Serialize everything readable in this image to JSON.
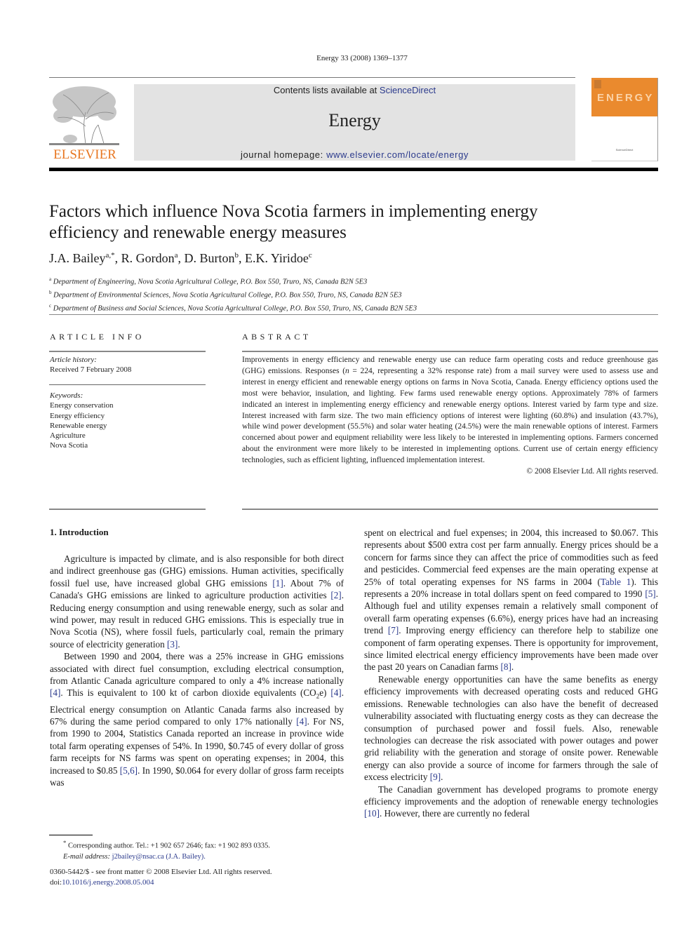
{
  "header": {
    "journal_ref": "Energy 33 (2008) 1369–1377",
    "contents_prefix": "Contents lists available at ",
    "contents_link": "ScienceDirect",
    "journal_name": "Energy",
    "homepage_prefix": "journal homepage: ",
    "homepage_link": "www.elsevier.com/locate/energy",
    "publisher_logo": "ELSEVIER",
    "cover_title": "ENERGY",
    "cover_footer": "ScienceDirect",
    "colors": {
      "brand_orange": "#e87722",
      "link_blue": "#2b3a8c",
      "banner_grey": "#e3e3e3"
    }
  },
  "article": {
    "title": "Factors which influence Nova Scotia farmers in implementing energy efficiency and renewable energy measures",
    "authors": [
      {
        "name": "J.A. Bailey",
        "sup": "a,*"
      },
      {
        "name": "R. Gordon",
        "sup": "a"
      },
      {
        "name": "D. Burton",
        "sup": "b"
      },
      {
        "name": "E.K. Yiridoe",
        "sup": "c"
      }
    ],
    "affiliations": [
      {
        "sup": "a",
        "text": "Department of Engineering, Nova Scotia Agricultural College, P.O. Box 550, Truro, NS, Canada B2N 5E3"
      },
      {
        "sup": "b",
        "text": "Department of Environmental Sciences, Nova Scotia Agricultural College, P.O. Box 550, Truro, NS, Canada B2N 5E3"
      },
      {
        "sup": "c",
        "text": "Department of Business and Social Sciences, Nova Scotia Agricultural College, P.O. Box 550, Truro, NS, Canada B2N 5E3"
      }
    ]
  },
  "article_info": {
    "heading": "ARTICLE INFO",
    "history_label": "Article history:",
    "received": "Received 7 February 2008",
    "keywords_label": "Keywords:",
    "keywords": [
      "Energy conservation",
      "Energy efficiency",
      "Renewable energy",
      "Agriculture",
      "Nova Scotia"
    ]
  },
  "abstract": {
    "heading": "ABSTRACT",
    "text_1": "Improvements in energy efficiency and renewable energy use can reduce farm operating costs and reduce greenhouse gas (GHG) emissions. Responses (",
    "n_var": "n",
    "text_2": " = 224, representing a 32% response rate) from a mail survey were used to assess use and interest in energy efficient and renewable energy options on farms in Nova Scotia, Canada. Energy efficiency options used the most were behavior, insulation, and lighting. Few farms used renewable energy options. Approximately 78% of farmers indicated an interest in implementing energy efficiency and renewable energy options. Interest varied by farm type and size. Interest increased with farm size. The two main efficiency options of interest were lighting (60.8%) and insulation (43.7%), while wind power development (55.5%) and solar water heating (24.5%) were the main renewable options of interest. Farmers concerned about power and equipment reliability were less likely to be interested in implementing options. Farmers concerned about the environment were more likely to be interested in implementing options. Current use of certain energy efficiency technologies, such as efficient lighting, influenced implementation interest.",
    "copyright": "© 2008 Elsevier Ltd. All rights reserved."
  },
  "body": {
    "section_heading": "1.  Introduction",
    "left": {
      "p1": [
        "Agriculture is impacted by climate, and is also responsible for both direct and indirect greenhouse gas (GHG) emissions. Human activities, specifically fossil fuel use, have increased global GHG emissions ",
        "[1]",
        ". About 7% of Canada's GHG emissions are linked to agriculture production activities ",
        "[2]",
        ". Reducing energy consumption and using renewable energy, such as solar and wind power, may result in reduced GHG emissions. This is especially true in Nova Scotia (NS), where fossil fuels, particularly coal, remain the primary source of electricity generation ",
        "[3]",
        "."
      ],
      "p2": [
        "Between 1990 and 2004, there was a 25% increase in GHG emissions associated with direct fuel consumption, excluding electrical consumption, from Atlantic Canada agriculture compared to only a 4% increase nationally ",
        "[4]",
        ". This is equivalent to 100 kt of carbon dioxide equivalents (CO",
        "2",
        "e) ",
        "[4]",
        ". Electrical energy consumption on Atlantic Canada farms also increased by 67% during the same period compared to only 17% nationally ",
        "[4]",
        ". For NS, from 1990 to 2004, Statistics Canada reported an increase in province wide total farm operating expenses of 54%. In 1990, $0.745 of every dollar of gross farm receipts for NS farms was spent on operating expenses; in 2004, this increased to $0.85 ",
        "[5,6]",
        ". In 1990, $0.064 for every dollar of gross farm receipts was"
      ]
    },
    "right": {
      "p1": [
        "spent on electrical and fuel expenses; in 2004, this increased to $0.067. This represents about $500 extra cost per farm annually. Energy prices should be a concern for farms since they can affect the price of commodities such as feed and pesticides. Commercial feed expenses are the main operating expense at 25% of total operating expenses for NS farms in 2004 (",
        "Table 1",
        "). This represents a 20% increase in total dollars spent on feed compared to 1990 ",
        "[5]",
        ". Although fuel and utility expenses remain a relatively small component of overall farm operating expenses (6.6%), energy prices have had an increasing trend ",
        "[7]",
        ". Improving energy efficiency can therefore help to stabilize one component of farm operating expenses. There is opportunity for improvement, since limited electrical energy efficiency improvements have been made over the past 20 years on Canadian farms ",
        "[8]",
        "."
      ],
      "p2": [
        "Renewable energy opportunities can have the same benefits as energy efficiency improvements with decreased operating costs and reduced GHG emissions. Renewable technologies can also have the benefit of decreased vulnerability associated with fluctuating energy costs as they can decrease the consumption of purchased power and fossil fuels. Also, renewable technologies can decrease the risk associated with power outages and power grid reliability with the generation and storage of onsite power. Renewable energy can also provide a source of income for farmers through the sale of excess electricity ",
        "[9]",
        "."
      ],
      "p3": [
        "The Canadian government has developed programs to promote energy efficiency improvements and the adoption of renewable energy technologies ",
        "[10]",
        ". However, there are currently no federal"
      ]
    }
  },
  "footnote": {
    "marker": "*",
    "corresponding": " Corresponding author. Tel.: +1 902 657 2646; fax: +1 902 893 0335.",
    "email_label": "E-mail address:",
    "email": "j2bailey@nsac.ca",
    "email_name": "(J.A. Bailey)."
  },
  "front_matter": {
    "issn_line": "0360-5442/$ - see front matter © 2008 Elsevier Ltd. All rights reserved.",
    "doi_prefix": "doi:",
    "doi": "10.1016/j.energy.2008.05.004"
  }
}
